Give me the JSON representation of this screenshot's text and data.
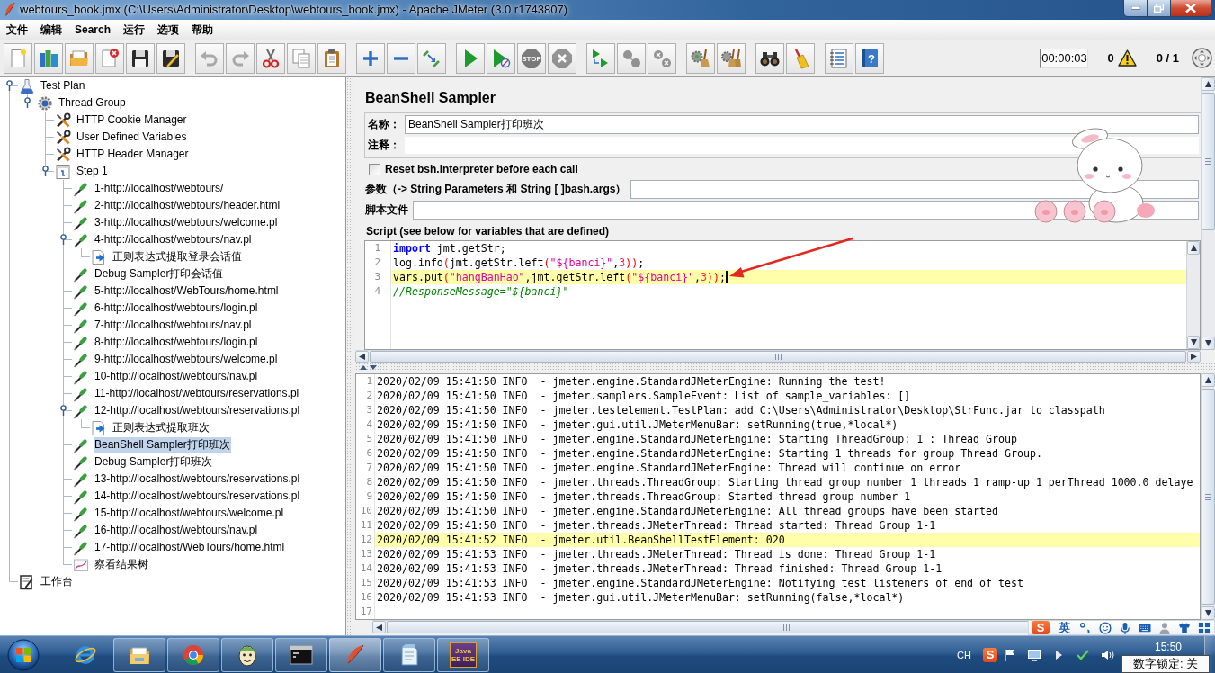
{
  "window": {
    "title": "webtours_book.jmx (C:\\Users\\Administrator\\Desktop\\webtours_book.jmx) - Apache JMeter (3.0 r1743807)"
  },
  "menu": [
    "文件",
    "编辑",
    "Search",
    "运行",
    "选项",
    "帮助"
  ],
  "toolbar": {
    "groups": [
      [
        {
          "disabled": false
        },
        {
          "disabled": false
        },
        {
          "disabled": false
        },
        {
          "disabled": false
        },
        {
          "disabled": false
        },
        {
          "disabled": false
        }
      ],
      [
        {
          "disabled": true
        },
        {
          "disabled": true
        },
        {
          "disabled": false
        },
        {
          "disabled": false
        },
        {
          "disabled": false
        }
      ],
      [
        {
          "disabled": false
        },
        {
          "disabled": false
        },
        {
          "disabled": false
        }
      ],
      [
        {
          "disabled": false
        },
        {
          "disabled": false
        },
        {
          "disabled": true,
          "icon_text": "STOP"
        },
        {
          "disabled": true
        }
      ],
      [
        {
          "disabled": false
        },
        {
          "disabled": true
        },
        {
          "disabled": true
        }
      ],
      [
        {
          "disabled": false
        },
        {
          "disabled": false
        }
      ],
      [
        {
          "disabled": false
        },
        {
          "disabled": false
        }
      ],
      [
        {
          "disabled": false
        },
        {
          "disabled": false,
          "icon_text": "?"
        }
      ]
    ],
    "elapsed_time": "00:00:03",
    "error_count": "0",
    "active_threads": "0 / 1"
  },
  "tree": [
    {
      "label": "Test Plan",
      "kind": "test-plan",
      "selected": false,
      "expanded": true,
      "children": [
        {
          "label": "Thread Group",
          "kind": "thread-group",
          "selected": false,
          "expanded": true,
          "children": [
            {
              "label": "HTTP Cookie Manager",
              "kind": "config",
              "selected": false
            },
            {
              "label": "User Defined Variables",
              "kind": "config",
              "selected": false
            },
            {
              "label": "HTTP Header Manager",
              "kind": "config",
              "selected": false
            },
            {
              "label": "Step 1",
              "kind": "controller",
              "selected": false,
              "expanded": true,
              "children": [
                {
                  "label": "1-http://localhost/webtours/",
                  "kind": "sampler",
                  "selected": false
                },
                {
                  "label": "2-http://localhost/webtours/header.html",
                  "kind": "sampler",
                  "selected": false
                },
                {
                  "label": "3-http://localhost/webtours/welcome.pl",
                  "kind": "sampler",
                  "selected": false
                },
                {
                  "label": "4-http://localhost/webtours/nav.pl",
                  "kind": "sampler",
                  "selected": false,
                  "expanded": true,
                  "children": [
                    {
                      "label": "正则表达式提取登录会话值",
                      "kind": "extractor",
                      "selected": false
                    }
                  ]
                },
                {
                  "label": "Debug Sampler打印会话值",
                  "kind": "sampler",
                  "selected": false
                },
                {
                  "label": "5-http://localhost/WebTours/home.html",
                  "kind": "sampler",
                  "selected": false
                },
                {
                  "label": "6-http://localhost/webtours/login.pl",
                  "kind": "sampler",
                  "selected": false
                },
                {
                  "label": "7-http://localhost/webtours/nav.pl",
                  "kind": "sampler",
                  "selected": false
                },
                {
                  "label": "8-http://localhost/webtours/login.pl",
                  "kind": "sampler",
                  "selected": false
                },
                {
                  "label": "9-http://localhost/webtours/welcome.pl",
                  "kind": "sampler",
                  "selected": false
                },
                {
                  "label": "10-http://localhost/webtours/nav.pl",
                  "kind": "sampler",
                  "selected": false
                },
                {
                  "label": "11-http://localhost/webtours/reservations.pl",
                  "kind": "sampler",
                  "selected": false
                },
                {
                  "label": "12-http://localhost/webtours/reservations.pl",
                  "kind": "sampler",
                  "selected": false,
                  "expanded": true,
                  "children": [
                    {
                      "label": "正则表达式提取班次",
                      "kind": "extractor",
                      "selected": false
                    }
                  ]
                },
                {
                  "label": "BeanShell Sampler打印班次",
                  "kind": "sampler",
                  "selected": true
                },
                {
                  "label": "Debug Sampler打印班次",
                  "kind": "sampler",
                  "selected": false
                },
                {
                  "label": "13-http://localhost/webtours/reservations.pl",
                  "kind": "sampler",
                  "selected": false
                },
                {
                  "label": "14-http://localhost/webtours/reservations.pl",
                  "kind": "sampler",
                  "selected": false
                },
                {
                  "label": "15-http://localhost/webtours/welcome.pl",
                  "kind": "sampler",
                  "selected": false
                },
                {
                  "label": "16-http://localhost/webtours/nav.pl",
                  "kind": "sampler",
                  "selected": false
                },
                {
                  "label": "17-http://localhost/WebTours/home.html",
                  "kind": "sampler",
                  "selected": false
                },
                {
                  "label": "察看结果树",
                  "kind": "listener",
                  "selected": false
                }
              ]
            }
          ]
        }
      ]
    },
    {
      "label": "工作台",
      "kind": "workbench",
      "selected": false
    }
  ],
  "sampler": {
    "title": "BeanShell Sampler",
    "name": {
      "label": "名称：",
      "value": "BeanShell Sampler打印班次"
    },
    "comment": {
      "label": "注释："
    },
    "reset_interpreter": {
      "label": "Reset bsh.Interpreter before each call",
      "checked": false
    },
    "parameters": {
      "label": "参数（-> String Parameters 和 String [ ]bash.args）"
    },
    "script_file": {
      "label": "脚本文件"
    },
    "script": {
      "label": "Script (see below for variables that are defined)",
      "lines": [
        {
          "number": "1",
          "highlighted": false,
          "caret": false,
          "tokens": [
            {
              "kind": "keyword",
              "text": "import"
            },
            {
              "kind": "plain",
              "text": " jmt.getStr;"
            }
          ]
        },
        {
          "number": "2",
          "highlighted": false,
          "caret": false,
          "tokens": [
            {
              "kind": "plain",
              "text": "log.info"
            },
            {
              "kind": "paren",
              "text": "("
            },
            {
              "kind": "plain",
              "text": "jmt.getStr.left"
            },
            {
              "kind": "paren",
              "text": "("
            },
            {
              "kind": "string",
              "text": "\"${banci}\""
            },
            {
              "kind": "plain",
              "text": ","
            },
            {
              "kind": "number",
              "text": "3"
            },
            {
              "kind": "paren",
              "text": "))"
            },
            {
              "kind": "plain",
              "text": ";"
            }
          ]
        },
        {
          "number": "3",
          "highlighted": true,
          "caret": true,
          "tokens": [
            {
              "kind": "plain",
              "text": "vars.put"
            },
            {
              "kind": "paren",
              "text": "("
            },
            {
              "kind": "string",
              "text": "\"hangBanHao\""
            },
            {
              "kind": "plain",
              "text": ",jmt.getStr.left"
            },
            {
              "kind": "paren",
              "text": "("
            },
            {
              "kind": "string",
              "text": "\"${banci}\""
            },
            {
              "kind": "plain",
              "text": ","
            },
            {
              "kind": "number",
              "text": "3"
            },
            {
              "kind": "paren",
              "text": "))"
            },
            {
              "kind": "plain",
              "text": ";"
            }
          ]
        },
        {
          "number": "4",
          "highlighted": false,
          "caret": false,
          "tokens": [
            {
              "kind": "comment",
              "text": "//ResponseMessage=\"${banci}\""
            }
          ]
        }
      ]
    }
  },
  "log": {
    "lines": [
      {
        "number": "1",
        "highlighted": false,
        "text": "2020/02/09 15:41:50 INFO  - jmeter.engine.StandardJMeterEngine: Running the test!"
      },
      {
        "number": "2",
        "highlighted": false,
        "text": "2020/02/09 15:41:50 INFO  - jmeter.samplers.SampleEvent: List of sample_variables: []"
      },
      {
        "number": "3",
        "highlighted": false,
        "text": "2020/02/09 15:41:50 INFO  - jmeter.testelement.TestPlan: add C:\\Users\\Administrator\\Desktop\\StrFunc.jar to classpath"
      },
      {
        "number": "4",
        "highlighted": false,
        "text": "2020/02/09 15:41:50 INFO  - jmeter.gui.util.JMeterMenuBar: setRunning(true,*local*)"
      },
      {
        "number": "5",
        "highlighted": false,
        "text": "2020/02/09 15:41:50 INFO  - jmeter.engine.StandardJMeterEngine: Starting ThreadGroup: 1 : Thread Group"
      },
      {
        "number": "6",
        "highlighted": false,
        "text": "2020/02/09 15:41:50 INFO  - jmeter.engine.StandardJMeterEngine: Starting 1 threads for group Thread Group."
      },
      {
        "number": "7",
        "highlighted": false,
        "text": "2020/02/09 15:41:50 INFO  - jmeter.engine.StandardJMeterEngine: Thread will continue on error"
      },
      {
        "number": "8",
        "highlighted": false,
        "text": "2020/02/09 15:41:50 INFO  - jmeter.threads.ThreadGroup: Starting thread group number 1 threads 1 ramp-up 1 perThread 1000.0 delaye"
      },
      {
        "number": "9",
        "highlighted": false,
        "text": "2020/02/09 15:41:50 INFO  - jmeter.threads.ThreadGroup: Started thread group number 1"
      },
      {
        "number": "10",
        "highlighted": false,
        "text": "2020/02/09 15:41:50 INFO  - jmeter.engine.StandardJMeterEngine: All thread groups have been started"
      },
      {
        "number": "11",
        "highlighted": false,
        "text": "2020/02/09 15:41:50 INFO  - jmeter.threads.JMeterThread: Thread started: Thread Group 1-1"
      },
      {
        "number": "12",
        "highlighted": true,
        "text": "2020/02/09 15:41:52 INFO  - jmeter.util.BeanShellTestElement: 020"
      },
      {
        "number": "13",
        "highlighted": false,
        "text": "2020/02/09 15:41:53 INFO  - jmeter.threads.JMeterThread: Thread is done: Thread Group 1-1"
      },
      {
        "number": "14",
        "highlighted": false,
        "text": "2020/02/09 15:41:53 INFO  - jmeter.threads.JMeterThread: Thread finished: Thread Group 1-1"
      },
      {
        "number": "15",
        "highlighted": false,
        "text": "2020/02/09 15:41:53 INFO  - jmeter.engine.StandardJMeterEngine: Notifying test listeners of end of test"
      },
      {
        "number": "16",
        "highlighted": false,
        "text": "2020/02/09 15:41:53 INFO  - jmeter.gui.util.JMeterMenuBar: setRunning(false,*local*)"
      },
      {
        "number": "17",
        "highlighted": false
      }
    ]
  },
  "ime_bar": {
    "logo": "S",
    "mode": "英"
  },
  "taskbar": {
    "apps": [
      {
        "open": false,
        "active": false
      },
      {
        "open": true,
        "active": false
      },
      {
        "open": true,
        "active": false
      },
      {
        "open": true,
        "active": false
      },
      {
        "open": true,
        "active": false
      },
      {
        "open": true,
        "active": true
      },
      {
        "open": true,
        "active": false
      },
      {
        "open": true,
        "active": false,
        "icon_text": "Java EE IDE"
      }
    ],
    "language": "CH",
    "ime_logo": "S",
    "clock": "15:50"
  },
  "numlock_tooltip": "数字锁定: 关"
}
